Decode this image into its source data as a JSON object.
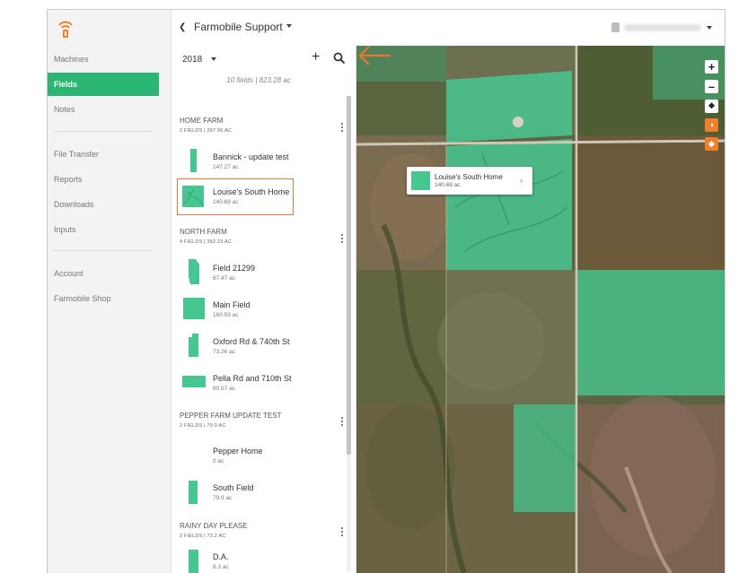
{
  "sidebar": {
    "items": [
      {
        "label": "Machines",
        "active": false
      },
      {
        "label": "Fields",
        "active": true
      },
      {
        "label": "Notes",
        "active": false
      },
      {
        "label": "File Transfer",
        "active": false
      },
      {
        "label": "Reports",
        "active": false
      },
      {
        "label": "Downloads",
        "active": false
      },
      {
        "label": "Inputs",
        "active": false
      },
      {
        "label": "Account",
        "active": false
      },
      {
        "label": "Farmobile Shop",
        "active": false
      }
    ]
  },
  "topbar": {
    "org_name": "Farmobile Support"
  },
  "panel": {
    "year": "2018",
    "summary": "10 fields | 823.28 ac",
    "farms": [
      {
        "name": "HOME FARM",
        "meta": "2 FIELDS | 287.96 AC",
        "fields": [
          {
            "name": "Bannick - update test",
            "area": "147.27 ac",
            "selected": false
          },
          {
            "name": "Louise's South Home",
            "area": "140.69 ac",
            "selected": true
          }
        ]
      },
      {
        "name": "NORTH FARM",
        "meta": "4 FIELDS | 382.23 AC",
        "fields": [
          {
            "name": "Field 21299",
            "area": "67.47 ac",
            "selected": false
          },
          {
            "name": "Main Field",
            "area": "160.93 ac",
            "selected": false
          },
          {
            "name": "Oxford Rd & 740th St",
            "area": "73.26 ac",
            "selected": false
          },
          {
            "name": "Pella Rd and 710th St",
            "area": "80.57 ac",
            "selected": false
          }
        ]
      },
      {
        "name": "PEPPER FARM UPDATE TEST",
        "meta": "2 FIELDS | 79.9 AC",
        "fields": [
          {
            "name": "Pepper Home",
            "area": "0 ac",
            "selected": false
          },
          {
            "name": "South Field",
            "area": "79.9 ac",
            "selected": false
          }
        ]
      },
      {
        "name": "RAINY DAY PLEASE",
        "meta": "2 FIELDS | 73.2 AC",
        "fields": [
          {
            "name": "D.A.",
            "area": "8.3 ac",
            "selected": false
          }
        ]
      }
    ]
  },
  "map": {
    "popup": {
      "name": "Louise's South Home",
      "area": "140.69 ac"
    },
    "controls": [
      "zoom-in",
      "zoom-out",
      "fullscreen",
      "basemap",
      "layers"
    ]
  },
  "colors": {
    "accent": "#2bb673",
    "field_fill": "#46c690",
    "annotation": "#e8773a",
    "map_control_orange": "#f07f2c"
  }
}
